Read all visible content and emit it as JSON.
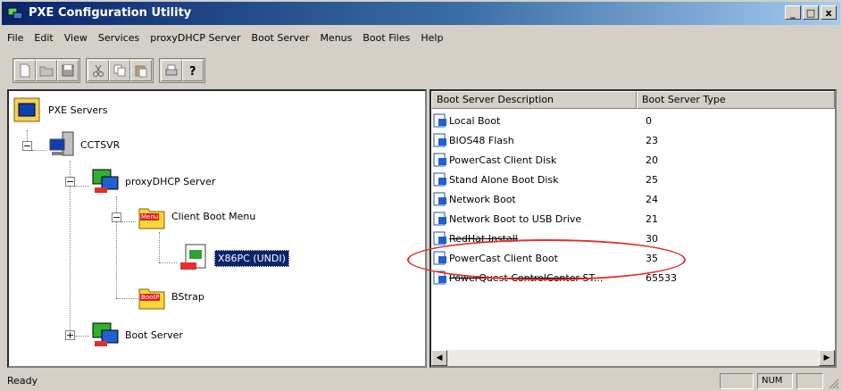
{
  "window": {
    "title": "PXE Configuration Utility",
    "buttons": {
      "minimize": "_",
      "maximize": "□",
      "close": "x"
    }
  },
  "menu": [
    "File",
    "Edit",
    "View",
    "Services",
    "proxyDHCP Server",
    "Boot Server",
    "Menus",
    "Boot Files",
    "Help"
  ],
  "tree": {
    "root": "PXE Servers",
    "server": "CCTSVR",
    "proxydhcp": "proxyDHCP Server",
    "menu": "Client Boot Menu",
    "menu_badge": "Menu",
    "selected_item": "X86PC (UNDI)",
    "bstrap": "BStrap",
    "bstrap_badge": "BootP",
    "bootserver": "Boot Server"
  },
  "list": {
    "columns": [
      "Boot Server Description",
      "Boot Server Type"
    ],
    "rows": [
      {
        "desc": "Local Boot",
        "type": "0"
      },
      {
        "desc": "BIOS48 Flash",
        "type": "23"
      },
      {
        "desc": "PowerCast Client Disk",
        "type": "20"
      },
      {
        "desc": "Stand Alone Boot Disk",
        "type": "25"
      },
      {
        "desc": "Network Boot",
        "type": "24"
      },
      {
        "desc": "Network Boot to USB Drive",
        "type": "21"
      },
      {
        "desc": "RedHat Install",
        "type": "30"
      },
      {
        "desc": "PowerCast Client Boot",
        "type": "35"
      },
      {
        "desc": "PowerQuest ControlCenter ST...",
        "type": "65533"
      }
    ]
  },
  "status": {
    "text": "Ready",
    "num": "NUM"
  },
  "colors": {
    "highlight": "#e0302a",
    "selection": "#0a246a"
  }
}
